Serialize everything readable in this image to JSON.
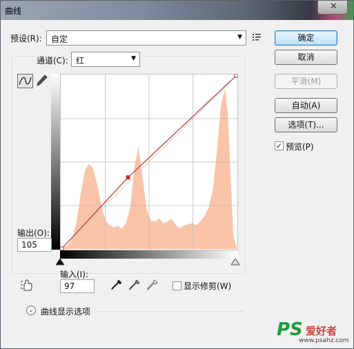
{
  "window": {
    "title": "曲线",
    "close_glyph": "✕"
  },
  "preset": {
    "label": "预设(R):",
    "value": "自定"
  },
  "channel": {
    "label": "通道(C):",
    "value": "红"
  },
  "buttons": {
    "ok": "确定",
    "cancel": "取消",
    "smooth": "平滑(M)",
    "auto": "自动(A)",
    "options": "选项(T)..."
  },
  "preview": {
    "label": "预览(P)",
    "checked": true
  },
  "output": {
    "label": "输出(O):",
    "value": "105"
  },
  "input": {
    "label": "输入(I):",
    "value": "97"
  },
  "show_clipping": {
    "label": "显示修剪(W)",
    "checked": false
  },
  "curve_display_options": {
    "label": "曲线显示选项"
  },
  "watermark": {
    "brand": "PS",
    "text": "爱好者",
    "url": "www.psahz.com"
  },
  "colors": {
    "curve": "#c0342b",
    "histogram": "#f9c4a7",
    "default_button": "#3c7fb1"
  },
  "chart_data": {
    "type": "area",
    "xlim": [
      0,
      255
    ],
    "ylim": [
      0,
      255
    ],
    "curve_points": [
      [
        0,
        0
      ],
      [
        97,
        105
      ],
      [
        255,
        255
      ]
    ],
    "histogram_x": [
      0,
      8,
      16,
      22,
      28,
      34,
      40,
      46,
      52,
      58,
      64,
      70,
      76,
      82,
      88,
      94,
      100,
      106,
      112,
      118,
      124,
      130,
      136,
      142,
      148,
      154,
      160,
      166,
      172,
      178,
      184,
      190,
      196,
      202,
      208,
      214,
      220,
      226,
      232,
      238,
      242,
      246,
      250,
      255
    ],
    "histogram_y": [
      2,
      4,
      15,
      40,
      80,
      115,
      125,
      118,
      95,
      65,
      42,
      35,
      32,
      34,
      30,
      38,
      60,
      118,
      150,
      105,
      58,
      42,
      40,
      45,
      38,
      40,
      44,
      36,
      30,
      34,
      36,
      38,
      35,
      40,
      48,
      60,
      85,
      140,
      210,
      235,
      200,
      110,
      20,
      2
    ]
  }
}
